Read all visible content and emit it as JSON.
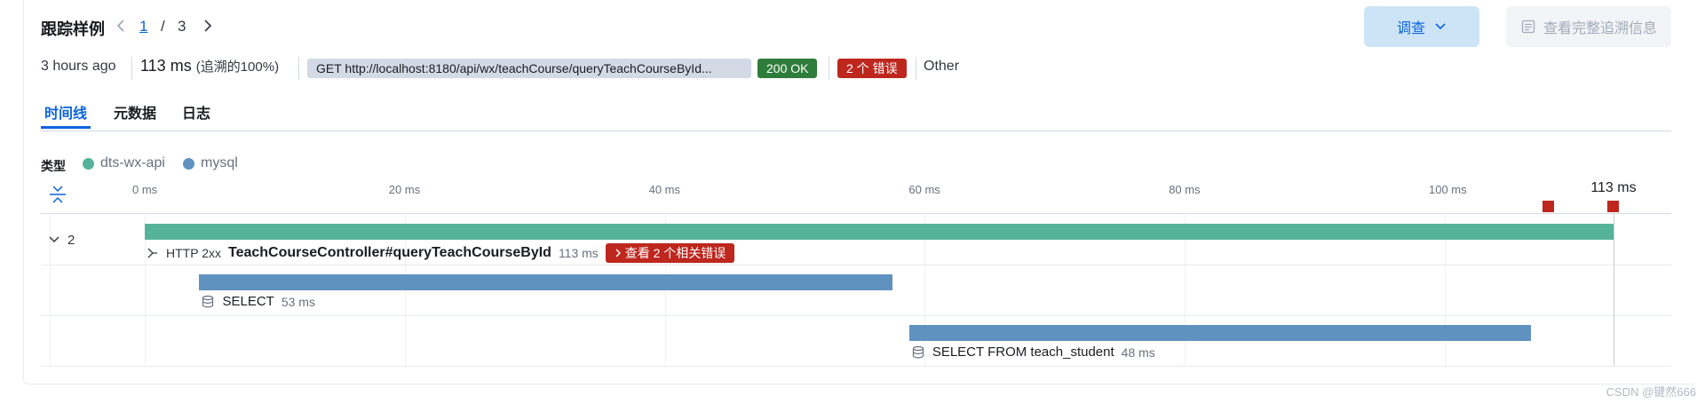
{
  "header": {
    "title": "跟踪样例",
    "page_current": "1",
    "page_separator": "/",
    "page_total": "3",
    "investigate_label": "调查",
    "full_trace_label": "查看完整追溯信息"
  },
  "meta": {
    "time_ago": "3 hours ago",
    "duration": "113 ms",
    "duration_pct": "(追溯的100%)",
    "request": "GET http://localhost:8180/api/wx/teachCourse/queryTeachCourseById...",
    "status": "200 OK",
    "errors": "2 个 错误",
    "type": "Other"
  },
  "tabs": [
    {
      "label": "时间线",
      "active": true
    },
    {
      "label": "元数据",
      "active": false
    },
    {
      "label": "日志",
      "active": false
    }
  ],
  "legend": {
    "label": "类型",
    "items": [
      {
        "name": "dts-wx-api",
        "color": "#54b399"
      },
      {
        "name": "mysql",
        "color": "#6092c0"
      }
    ]
  },
  "timeline": {
    "total_ms": 113,
    "ticks": [
      {
        "ms": 0,
        "label": "0 ms"
      },
      {
        "ms": 20,
        "label": "20 ms"
      },
      {
        "ms": 40,
        "label": "40 ms"
      },
      {
        "ms": 60,
        "label": "60 ms"
      },
      {
        "ms": 80,
        "label": "80 ms"
      },
      {
        "ms": 100,
        "label": "100 ms"
      }
    ],
    "end_label": "113 ms",
    "error_markers_ms": [
      108,
      113
    ]
  },
  "spans": [
    {
      "toggle_label": "2",
      "start_ms": 0,
      "duration_ms": 113,
      "color": "#54b399",
      "type_label": "HTTP 2xx",
      "name": "TeachCourseController#queryTeachCourseById",
      "duration_label": "113 ms",
      "error_label": "查看 2 个相关错误"
    },
    {
      "start_ms": 4.2,
      "duration_ms": 53.3,
      "color": "#6092c0",
      "name": "SELECT",
      "duration_label": "53 ms"
    },
    {
      "start_ms": 58.8,
      "duration_ms": 47.8,
      "color": "#6092c0",
      "name": "SELECT FROM teach_student",
      "duration_label": "48 ms"
    }
  ],
  "watermark": "CSDN @键然666"
}
